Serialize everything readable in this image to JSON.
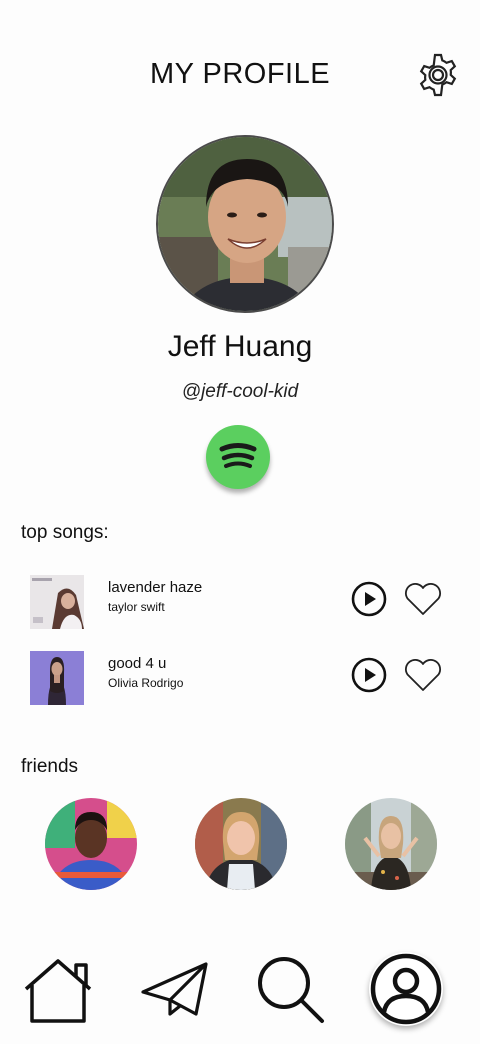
{
  "header": {
    "title": "MY PROFILE"
  },
  "profile": {
    "name": "Jeff Huang",
    "handle": "@jeff-cool-kid"
  },
  "top_songs": {
    "title": "top songs:",
    "items": [
      {
        "title": "lavender haze",
        "artist": "taylor swift"
      },
      {
        "title": "good 4 u",
        "artist": "Olivia Rodrigo"
      }
    ]
  },
  "friends": {
    "title": "friends"
  },
  "nav": {
    "items": [
      "home-icon",
      "send-icon",
      "search-icon",
      "profile-icon"
    ]
  },
  "colors": {
    "spotify_green": "#5bcf5f",
    "text": "#111111"
  }
}
